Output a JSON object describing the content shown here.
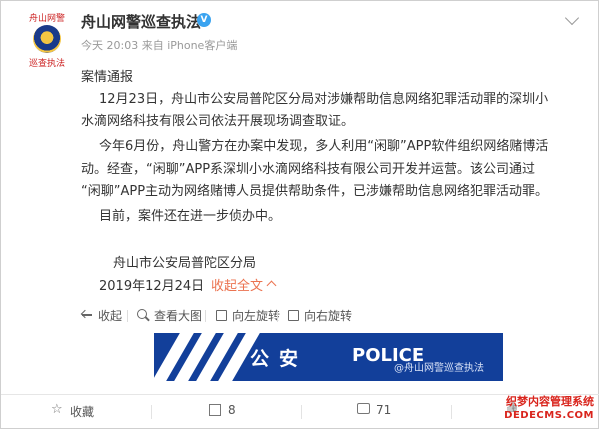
{
  "post": {
    "avatar": {
      "top_text": "舟山网警",
      "bottom_text": "巡查执法"
    },
    "username": "舟山网警巡查执法",
    "verified_badge": "V",
    "meta": "今天 20:03 来自 iPhone客户端",
    "title": "案情通报",
    "p1_line1": "12月23日，舟山市公安局普陀区分局对涉嫌帮助信息网络犯罪活动罪的深圳小",
    "p1_line2": "水滴网络科技有限公司依法开展现场调查取证。",
    "p2_line1": "今年6月份，舟山警方在办案中发现，多人利用“闲聊”APP软件组织网络赌博活",
    "p2_line2": "动。经查，“闲聊”APP系深圳小水滴网络科技有限公司开发并运营。该公司通过",
    "p2_line3": "“闲聊”APP主动为网络赌博人员提供帮助条件，已涉嫌帮助信息网络犯罪活动罪。",
    "p3": "目前，案件还在进一步侦办中。",
    "signature": "舟山市公安局普陀区分局",
    "date": "2019年12月24日",
    "collapse_label": "收起全文"
  },
  "toolbar": {
    "back_label": "收起",
    "zoom_label": "查看大图",
    "rotate_left_label": "向左旋转",
    "rotate_right_label": "向右旋转"
  },
  "banner": {
    "text_cn": "公安",
    "text_en": "POLICE",
    "watermark": "@舟山网警巡查执法",
    "colors": {
      "background": "#123f9a",
      "stripes": "#ffffff"
    }
  },
  "actions": {
    "favorite_label": "收藏",
    "share_count": "8",
    "comment_count": "71",
    "like_count": ""
  },
  "corner_watermark": {
    "line1": "织梦内容管理系统",
    "line2": "DEDECMS.COM"
  },
  "colors": {
    "accent_link": "#eb7350",
    "verified": "#3aa3f0",
    "brand_red": "#d9241c"
  }
}
